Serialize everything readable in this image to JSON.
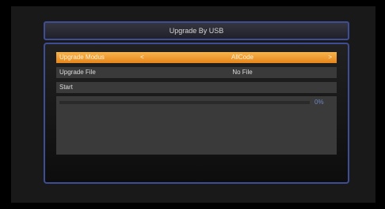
{
  "dialog": {
    "title": "Upgrade By USB"
  },
  "rows": [
    {
      "label": "Upgrade Modus",
      "value": "AllCode"
    },
    {
      "label": "Upgrade File",
      "value": "No File"
    },
    {
      "label": "Start"
    }
  ],
  "progress": {
    "value": 0,
    "text": "0%"
  },
  "colors": {
    "accent": "#3f4d95",
    "highlight": "#f0a030",
    "progress_bar": "#8c2020"
  },
  "icons": [
    "chevron-left-icon",
    "chevron-right-icon"
  ]
}
